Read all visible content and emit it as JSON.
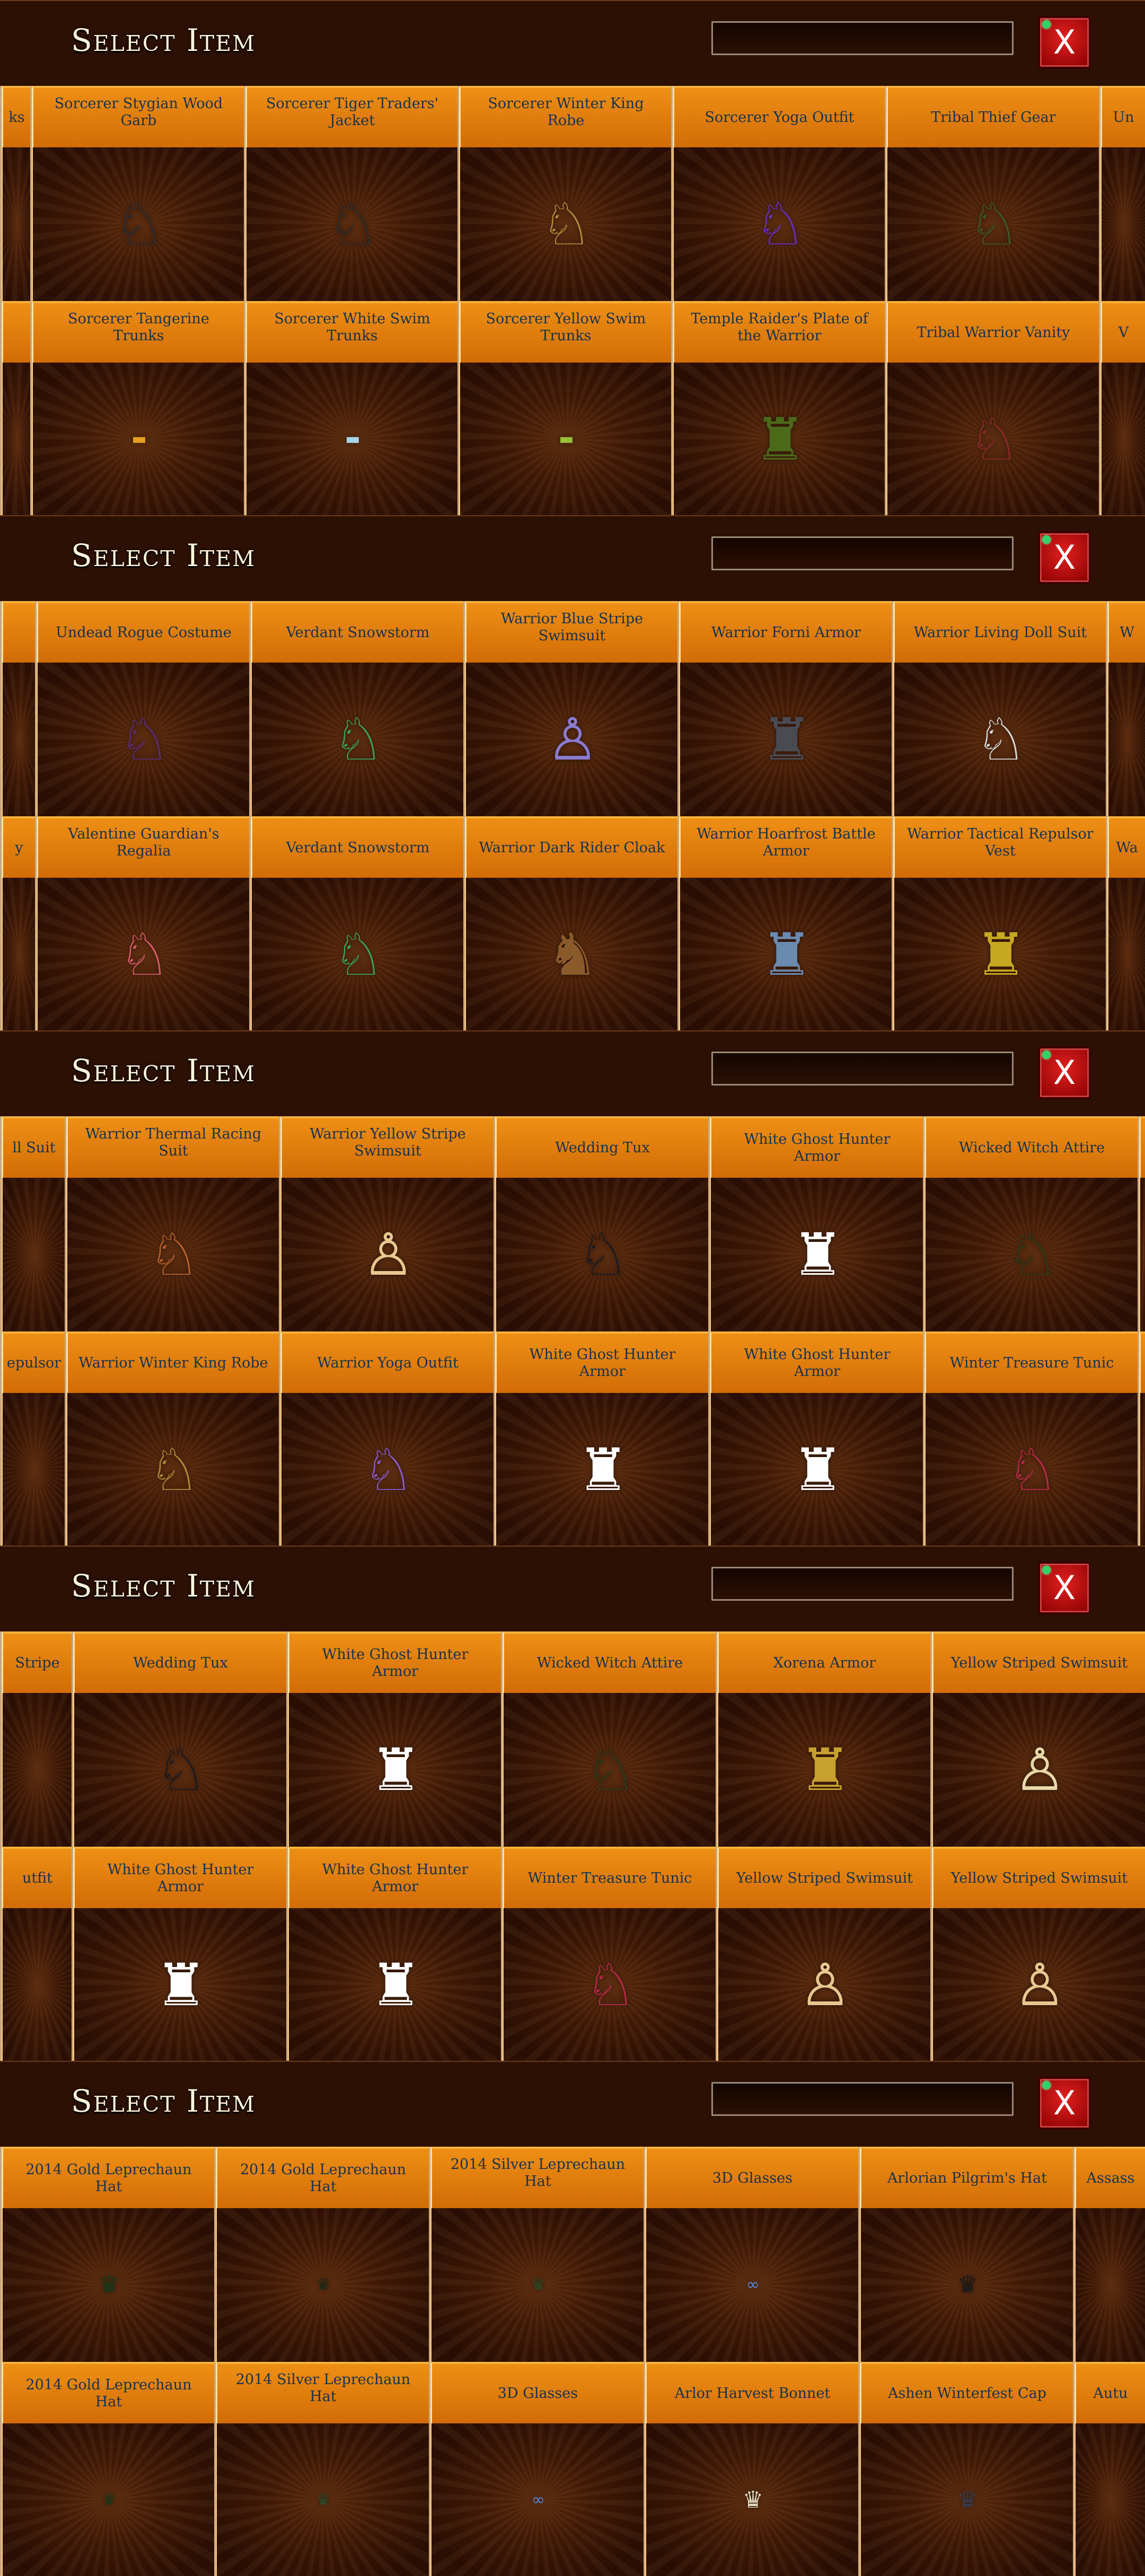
{
  "panels": [
    {
      "title": "Select Item",
      "close_label": "X",
      "rows": [
        [
          {
            "label": "ks",
            "icon": "outfit-icon"
          },
          {
            "label": "Sorcerer Stygian Wood Garb",
            "icon": "outfit-icon",
            "color": "#2a2a30"
          },
          {
            "label": "Sorcerer Tiger Traders' Jacket",
            "icon": "outfit-icon",
            "color": "#2b2b2b"
          },
          {
            "label": "Sorcerer Winter King Robe",
            "icon": "outfit-icon",
            "color": "#b08a3a"
          },
          {
            "label": "Sorcerer Yoga Outfit",
            "icon": "outfit-icon",
            "color": "#6a2fc2"
          },
          {
            "label": "Tribal Thief Gear",
            "icon": "outfit-icon",
            "color": "#3a5a2a"
          },
          {
            "label": "Un",
            "icon": "outfit-icon"
          }
        ],
        [
          {
            "label": "",
            "icon": "outfit-icon"
          },
          {
            "label": "Sorcerer Tangerine Trunks",
            "icon": "trunks-icon",
            "color": "#e8a020",
            "size": "tiny"
          },
          {
            "label": "Sorcerer White Swim Trunks",
            "icon": "trunks-icon",
            "color": "#a8d4e8",
            "size": "tiny"
          },
          {
            "label": "Sorcerer Yellow Swim Trunks",
            "icon": "trunks-icon",
            "color": "#9abf3a",
            "size": "tiny"
          },
          {
            "label": "Temple Raider's Plate of the Warrior",
            "icon": "armor-icon",
            "color": "#4a6a1a"
          },
          {
            "label": "Tribal Warrior Vanity",
            "icon": "outfit-icon",
            "color": "#8a2a2a"
          },
          {
            "label": "V",
            "icon": "outfit-icon"
          }
        ]
      ]
    },
    {
      "title": "Select Item",
      "close_label": "X",
      "rows": [
        [
          {
            "label": "",
            "icon": "outfit-icon"
          },
          {
            "label": "Undead Rogue Costume",
            "icon": "outfit-icon",
            "color": "#5a2a7a"
          },
          {
            "label": "Verdant Snowstorm",
            "icon": "outfit-icon",
            "color": "#3aa05a"
          },
          {
            "label": "Warrior Blue Stripe Swimsuit",
            "icon": "swimsuit-icon",
            "color": "#8a7ad0"
          },
          {
            "label": "Warrior Forni Armor",
            "icon": "armor-icon",
            "color": "#4a4a52"
          },
          {
            "label": "Warrior Living Doll Suit",
            "icon": "outfit-icon",
            "color": "#d8d8d8"
          },
          {
            "label": "W",
            "icon": "outfit-icon"
          }
        ],
        [
          {
            "label": "y",
            "icon": "outfit-icon"
          },
          {
            "label": "Valentine Guardian's Regalia",
            "icon": "outfit-icon",
            "color": "#d85a6a"
          },
          {
            "label": "Verdant Snowstorm",
            "icon": "outfit-icon",
            "color": "#3aa05a"
          },
          {
            "label": "Warrior Dark Rider Cloak",
            "icon": "cloak-icon",
            "color": "#8a5a2a"
          },
          {
            "label": "Warrior Hoarfrost Battle Armor",
            "icon": "armor-icon",
            "color": "#6a8ab0"
          },
          {
            "label": "Warrior Tactical Repulsor Vest",
            "icon": "armor-icon",
            "color": "#c8a820"
          },
          {
            "label": "Wa",
            "icon": "outfit-icon"
          }
        ]
      ]
    },
    {
      "title": "Select Item",
      "close_label": "X",
      "rows": [
        [
          {
            "label": "ll Suit",
            "icon": "outfit-icon"
          },
          {
            "label": "Warrior Thermal Racing Suit",
            "icon": "outfit-icon",
            "color": "#b8622a"
          },
          {
            "label": "Warrior Yellow Stripe Swimsuit",
            "icon": "swimsuit-icon",
            "color": "#e8c890"
          },
          {
            "label": "Wedding Tux",
            "icon": "outfit-icon",
            "color": "#1a1a22"
          },
          {
            "label": "White Ghost Hunter Armor",
            "icon": "armor-icon",
            "color": "#ffffff"
          },
          {
            "label": "Wicked Witch Attire",
            "icon": "outfit-icon",
            "color": "#2a3a1a"
          },
          {
            "label": "",
            "icon": "outfit-icon"
          }
        ],
        [
          {
            "label": "epulsor",
            "icon": "outfit-icon"
          },
          {
            "label": "Warrior Winter King Robe",
            "icon": "outfit-icon",
            "color": "#b08a3a"
          },
          {
            "label": "Warrior Yoga Outfit",
            "icon": "outfit-icon",
            "color": "#8a5ad0"
          },
          {
            "label": "White Ghost Hunter Armor",
            "icon": "armor-icon",
            "color": "#ffffff"
          },
          {
            "label": "White Ghost Hunter Armor",
            "icon": "armor-icon",
            "color": "#ffffff"
          },
          {
            "label": "Winter Treasure Tunic",
            "icon": "outfit-icon",
            "color": "#b82a4a"
          },
          {
            "label": "",
            "icon": "outfit-icon"
          }
        ]
      ]
    },
    {
      "title": "Select Item",
      "close_label": "X",
      "rows": [
        [
          {
            "label": "Stripe",
            "icon": "outfit-icon"
          },
          {
            "label": "Wedding Tux",
            "icon": "outfit-icon",
            "color": "#1a1a22"
          },
          {
            "label": "White Ghost Hunter Armor",
            "icon": "armor-icon",
            "color": "#ffffff"
          },
          {
            "label": "Wicked Witch Attire",
            "icon": "outfit-icon",
            "color": "#2a3a1a"
          },
          {
            "label": "Xorena Armor",
            "icon": "armor-icon",
            "color": "#c8a030"
          },
          {
            "label": "Yellow Striped Swimsuit",
            "icon": "swimsuit-icon",
            "color": "#e8d8a8"
          },
          {
            "label": "",
            "icon": "outfit-icon"
          }
        ],
        [
          {
            "label": "utfit",
            "icon": "outfit-icon"
          },
          {
            "label": "White Ghost Hunter Armor",
            "icon": "armor-icon",
            "color": "#ffffff"
          },
          {
            "label": "White Ghost Hunter Armor",
            "icon": "armor-icon",
            "color": "#ffffff"
          },
          {
            "label": "Winter Treasure Tunic",
            "icon": "outfit-icon",
            "color": "#b82a4a"
          },
          {
            "label": "Yellow Striped Swimsuit",
            "icon": "swimsuit-icon",
            "color": "#e8c890"
          },
          {
            "label": "Yellow Striped Swimsuit",
            "icon": "swimsuit-icon",
            "color": "#e8c890"
          },
          {
            "label": "",
            "icon": "outfit-icon"
          }
        ]
      ]
    },
    {
      "title": "Select Item",
      "close_label": "X",
      "rows": [
        [
          {
            "label": "2014 Gold Leprechaun Hat",
            "icon": "hat-icon",
            "color": "#1a3a1a",
            "size": "small"
          },
          {
            "label": "2014 Gold Leprechaun Hat",
            "icon": "hat-icon",
            "color": "#1a2a1a",
            "size": "tiny"
          },
          {
            "label": "2014 Silver Leprechaun Hat",
            "icon": "hat-icon",
            "color": "#2a4a2a",
            "size": "tiny"
          },
          {
            "label": "3D Glasses",
            "icon": "glasses-icon",
            "color": "#5a8ad0",
            "size": "tiny"
          },
          {
            "label": "Arlorian Pilgrim's Hat",
            "icon": "hat-icon",
            "color": "#1a1a1a",
            "size": "small"
          },
          {
            "label": "Assass",
            "icon": "hat-icon",
            "size": "small"
          }
        ],
        [
          {
            "label": "2014 Gold Leprechaun Hat",
            "icon": "hat-icon",
            "color": "#1a3a1a",
            "size": "tiny"
          },
          {
            "label": "2014 Silver Leprechaun Hat",
            "icon": "hat-icon",
            "color": "#2a4a2a",
            "size": "tiny"
          },
          {
            "label": "3D Glasses",
            "icon": "glasses-icon",
            "color": "#5a8ad0",
            "size": "tiny"
          },
          {
            "label": "Arlor Harvest Bonnet",
            "icon": "hat-icon",
            "color": "#e0d8c0",
            "size": "small"
          },
          {
            "label": "Ashen Winterfest Cap",
            "icon": "hat-icon",
            "color": "#3a3a4a",
            "size": "small"
          },
          {
            "label": "Autu",
            "icon": "hat-icon",
            "size": "small"
          }
        ]
      ]
    }
  ]
}
